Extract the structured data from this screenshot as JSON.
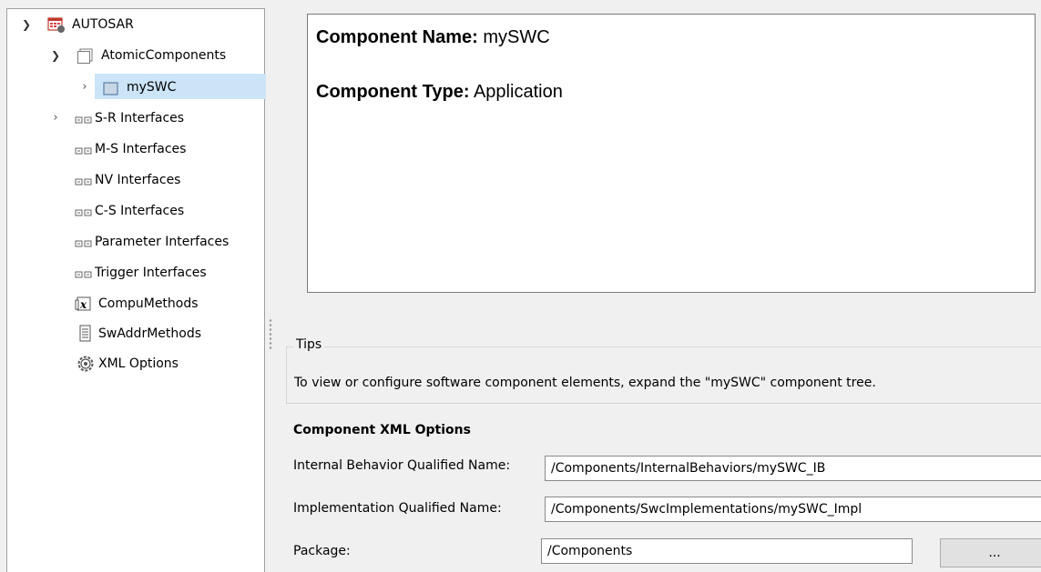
{
  "tree": {
    "root": {
      "label": "AUTOSAR",
      "icon": "autosar-app-icon",
      "expanded": true
    },
    "atomic": {
      "label": "AtomicComponents",
      "icon": "package-icon",
      "expanded": true
    },
    "swc": {
      "label": "mySWC",
      "icon": "component-icon",
      "expanded": false,
      "selected": true
    },
    "items": [
      {
        "label": "S-R Interfaces",
        "icon": "interface-icon",
        "has_children": true
      },
      {
        "label": "M-S Interfaces",
        "icon": "interface-icon",
        "has_children": false
      },
      {
        "label": "NV Interfaces",
        "icon": "interface-icon",
        "has_children": false
      },
      {
        "label": "C-S Interfaces",
        "icon": "interface-icon",
        "has_children": false
      },
      {
        "label": "Parameter Interfaces",
        "icon": "interface-icon",
        "has_children": false
      },
      {
        "label": "Trigger Interfaces",
        "icon": "interface-icon",
        "has_children": false
      },
      {
        "label": "CompuMethods",
        "icon": "compu-method-icon",
        "has_children": false
      },
      {
        "label": "SwAddrMethods",
        "icon": "document-icon",
        "has_children": false
      },
      {
        "label": "XML Options",
        "icon": "gear-icon",
        "has_children": false
      }
    ]
  },
  "summary": {
    "name_label": "Component Name:",
    "name_value": " mySWC",
    "type_label": "Component Type:",
    "type_value": " Application"
  },
  "tips": {
    "legend": "Tips",
    "text": "To view or configure software component elements, expand the \"mySWC\" component tree."
  },
  "xml_options": {
    "title": "Component XML Options",
    "internal_behavior_label": "Internal Behavior Qualified Name:",
    "internal_behavior_value": "/Components/InternalBehaviors/mySWC_IB",
    "implementation_label": "Implementation Qualified Name:",
    "implementation_value": "/Components/SwcImplementations/mySWC_Impl",
    "package_label": "Package:",
    "package_value": "/Components",
    "browse_label": "..."
  },
  "colors": {
    "selection": "#cce4f7",
    "panel_bg": "#f0f0f0"
  }
}
